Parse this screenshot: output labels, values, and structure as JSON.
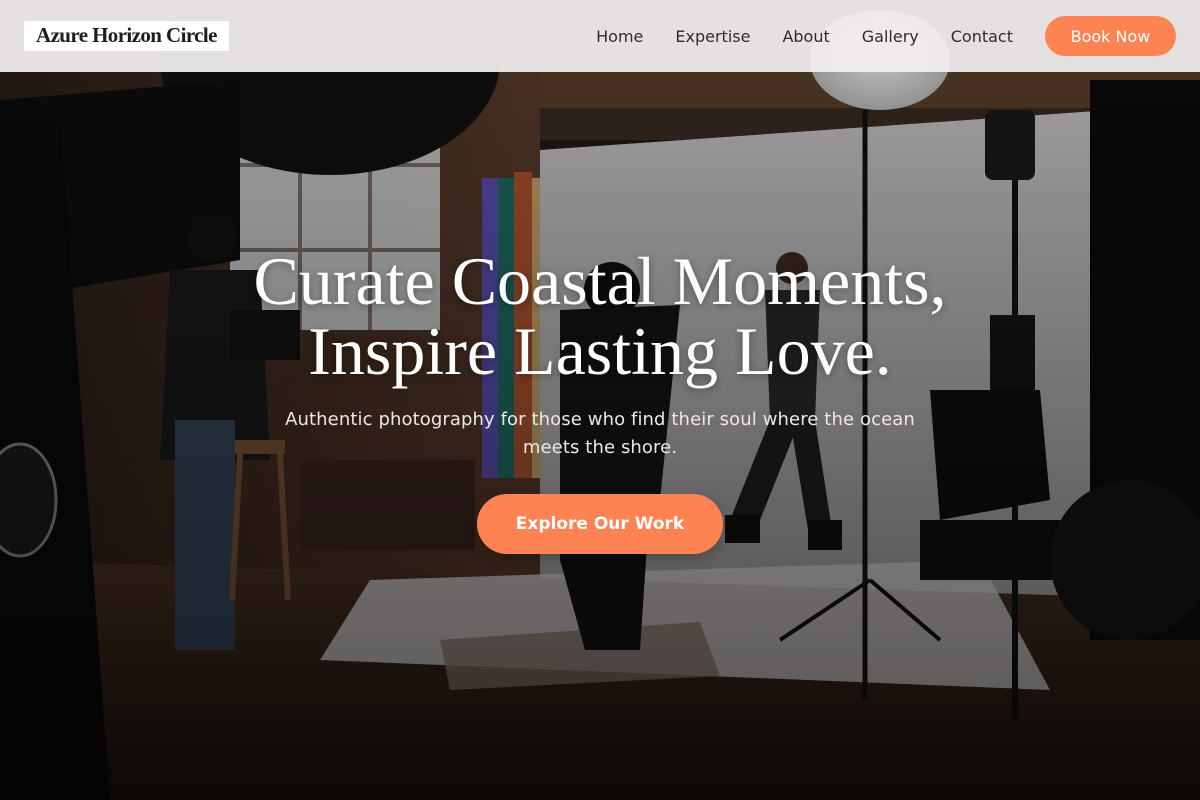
{
  "header": {
    "logo_text": "Azure Horizon Circle",
    "nav": [
      {
        "label": "Home"
      },
      {
        "label": "Expertise"
      },
      {
        "label": "About"
      },
      {
        "label": "Gallery"
      },
      {
        "label": "Contact"
      }
    ],
    "cta_label": "Book Now"
  },
  "hero": {
    "headline_line1": "Curate Coastal Moments,",
    "headline_line2": "Inspire Lasting Love.",
    "subtitle": "Authentic photography for those who find their soul where the ocean meets the shore.",
    "cta_label": "Explore Our Work",
    "background_image": "photo-studio-shoot-scene"
  },
  "colors": {
    "accent": "#fe8353",
    "header_bg": "#f3f0ef",
    "headline": "#ffffff",
    "nav_text": "#2c2c2c"
  }
}
